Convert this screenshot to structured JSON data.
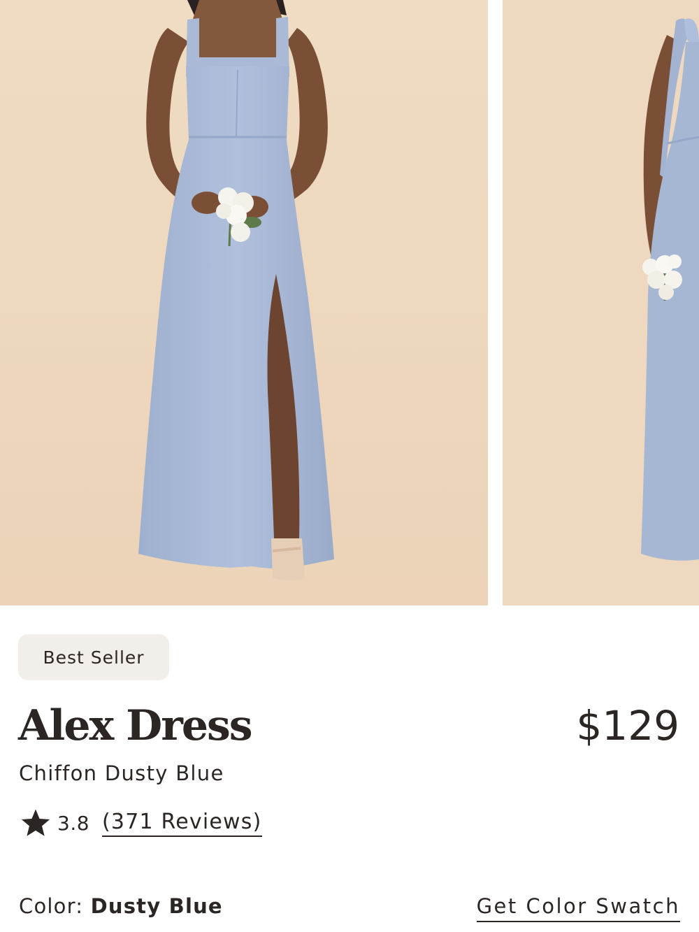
{
  "gallery": {
    "images": [
      {
        "alt": "model-front-view"
      },
      {
        "alt": "model-side-view"
      }
    ]
  },
  "product": {
    "badge": "Best Seller",
    "name": "Alex Dress",
    "price": "$129",
    "subtitle": "Chiffon Dusty Blue",
    "rating": "3.8",
    "reviews_label": "(371 Reviews)",
    "color_label": "Color: ",
    "color_value": "Dusty Blue",
    "swatch_link": "Get Color Swatch"
  },
  "colors": {
    "background_photo": "#edd6bb",
    "dress": "#a9b9d6",
    "text": "#2b2624",
    "badge_bg": "#f2efeb"
  }
}
